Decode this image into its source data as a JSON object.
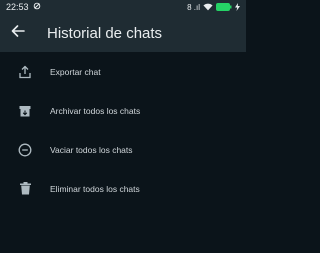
{
  "status_bar": {
    "time": "22:53",
    "signal_text": "8 .ıl"
  },
  "header": {
    "title": "Historial de chats",
    "back_icon": "arrow-left-icon"
  },
  "menu": {
    "items": [
      {
        "label": "Exportar chat",
        "icon": "share-icon"
      },
      {
        "label": "Archivar todos los chats",
        "icon": "archive-icon"
      },
      {
        "label": "Vaciar todos los chats",
        "icon": "minus-circle-icon"
      },
      {
        "label": "Eliminar todos los chats",
        "icon": "trash-icon"
      }
    ]
  },
  "colors": {
    "background": "#0b141a",
    "bar": "#1f2c33",
    "text": "#e9edef",
    "icon": "#aebac1",
    "battery": "#25d366"
  }
}
